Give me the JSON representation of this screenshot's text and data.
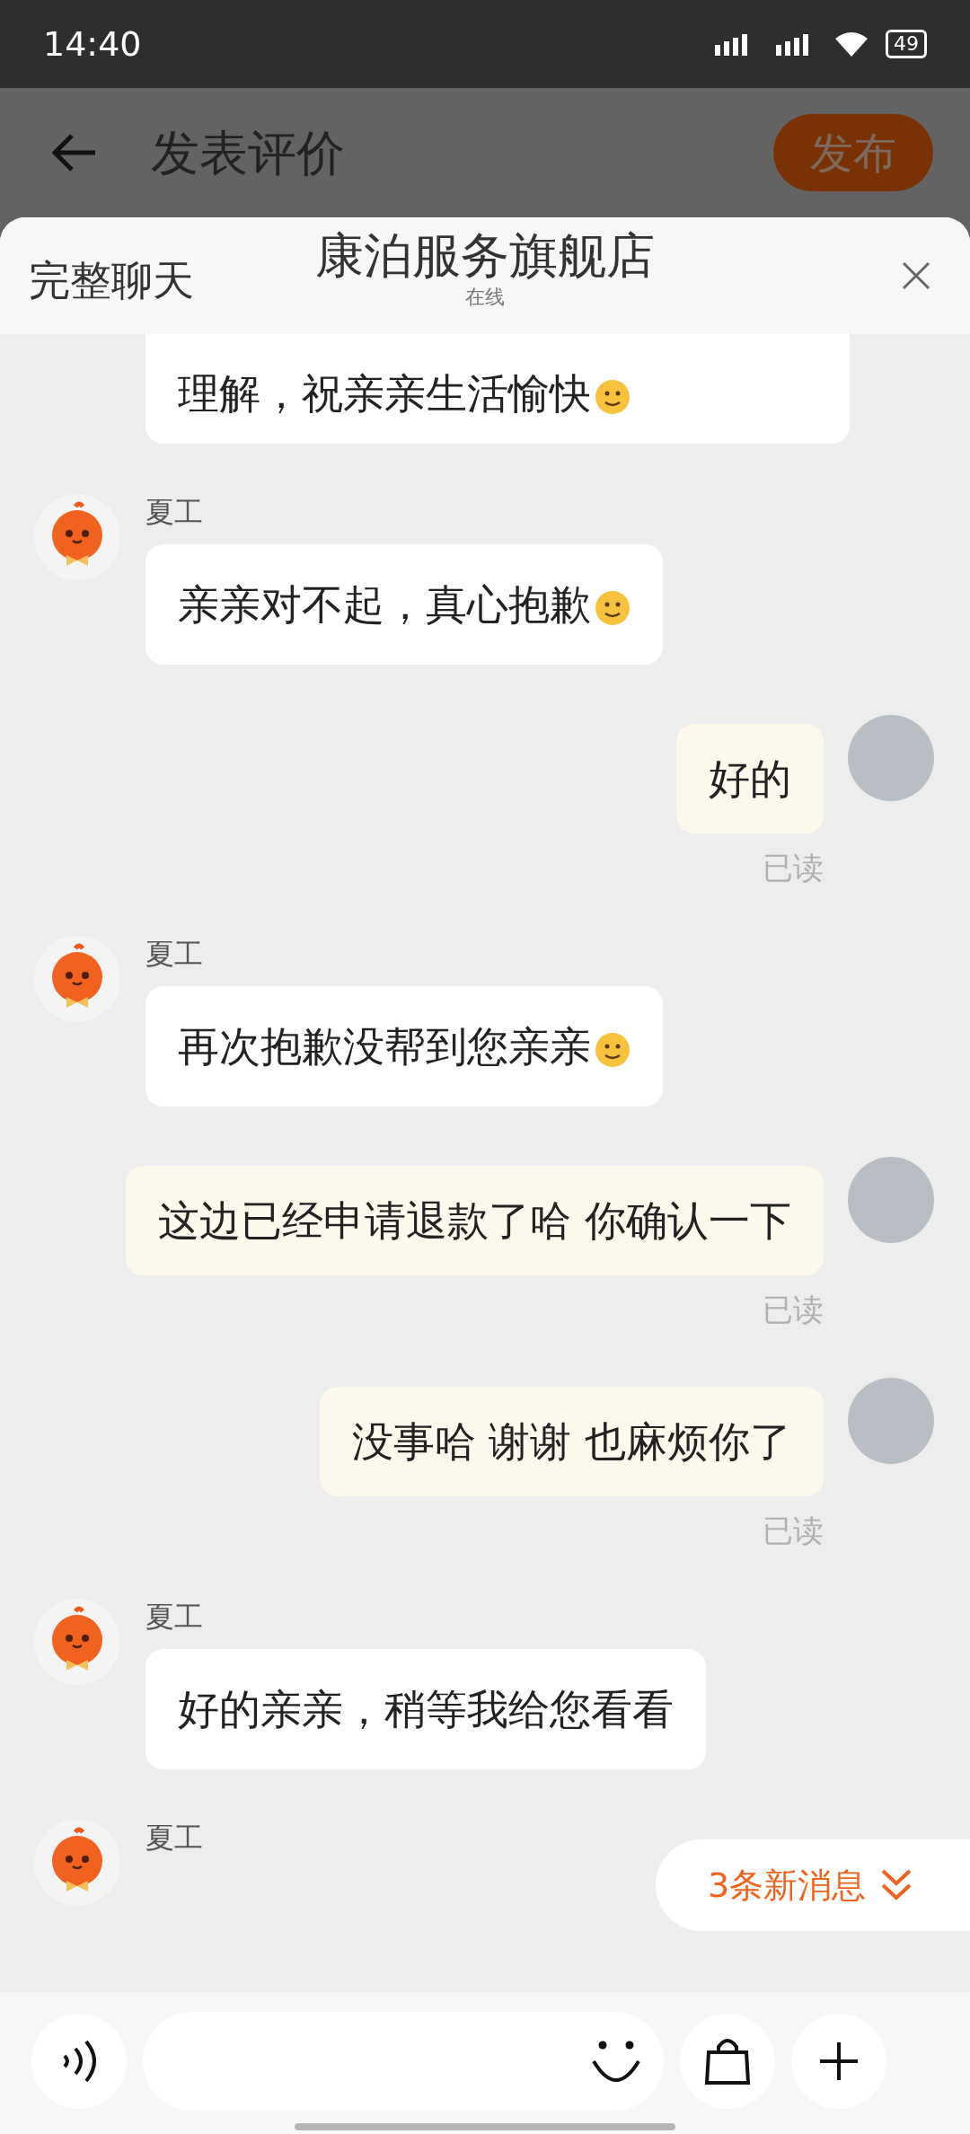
{
  "status_bar": {
    "time": "14:40",
    "battery": "49"
  },
  "header": {
    "title": "发表评价",
    "publish_button": "发布"
  },
  "chat": {
    "full_chat_link": "完整聊天",
    "shop_name": "康泊服务旗舰店",
    "status": "在线"
  },
  "messages": [
    {
      "kind": "agent_partial",
      "text": "理解，祝亲亲生活愉快",
      "emoji": true
    },
    {
      "kind": "agent",
      "sender": "夏工",
      "text": "亲亲对不起，真心抱歉",
      "emoji": true
    },
    {
      "kind": "user",
      "text": "好的",
      "emoji": false,
      "read_label": "已读"
    },
    {
      "kind": "agent",
      "sender": "夏工",
      "text": "再次抱歉没帮到您亲亲",
      "emoji": true
    },
    {
      "kind": "user",
      "text": "这边已经申请退款了哈 你确认一下",
      "emoji": false,
      "read_label": "已读"
    },
    {
      "kind": "user",
      "text": "没事哈 谢谢 也麻烦你了",
      "emoji": false,
      "read_label": "已读"
    },
    {
      "kind": "agent",
      "sender": "夏工",
      "text": "好的亲亲，稍等我给您看看",
      "emoji": false
    },
    {
      "kind": "agent_cut",
      "sender": "夏工"
    }
  ],
  "new_messages_pill": "3条新消息"
}
